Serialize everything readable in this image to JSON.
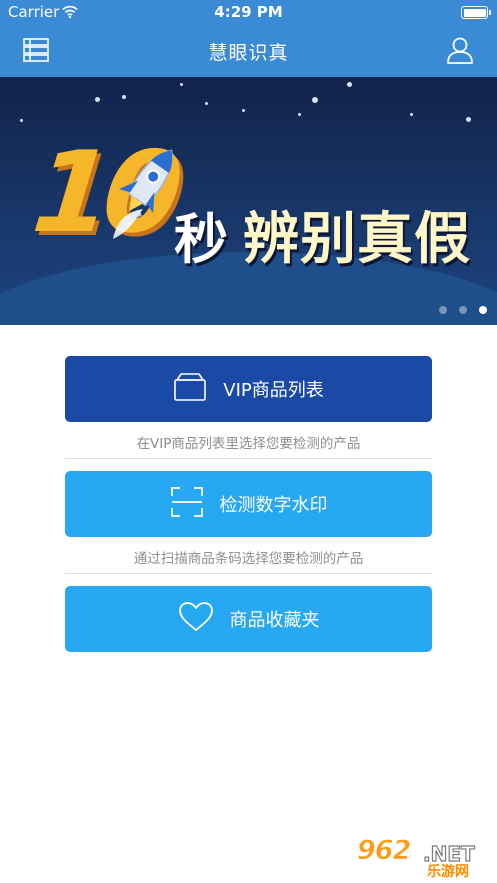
{
  "status_bar": {
    "carrier": "Carrier",
    "time": "4:29 PM"
  },
  "nav": {
    "title": "慧眼识真",
    "menu_icon": "list-menu-icon",
    "user_icon": "user-profile-icon"
  },
  "banner": {
    "number": "10",
    "slogan_part1": "秒",
    "slogan_part2": "辨别真假",
    "page_count": 3,
    "active_page": 3
  },
  "actions": [
    {
      "label": "VIP商品列表",
      "hint": "在VIP商品列表里选择您要检测的产品",
      "icon": "box-icon",
      "color": "#1b4aa6"
    },
    {
      "label": "检测数字水印",
      "hint": "通过扫描商品条码选择您要检测的产品",
      "icon": "scan-frame-icon",
      "color": "#27a8f2"
    },
    {
      "label": "商品收藏夹",
      "icon": "heart-icon",
      "color": "#27a8f2"
    }
  ],
  "watermark": {
    "number": "962",
    "suffix": ".NET",
    "name": "乐游网"
  }
}
